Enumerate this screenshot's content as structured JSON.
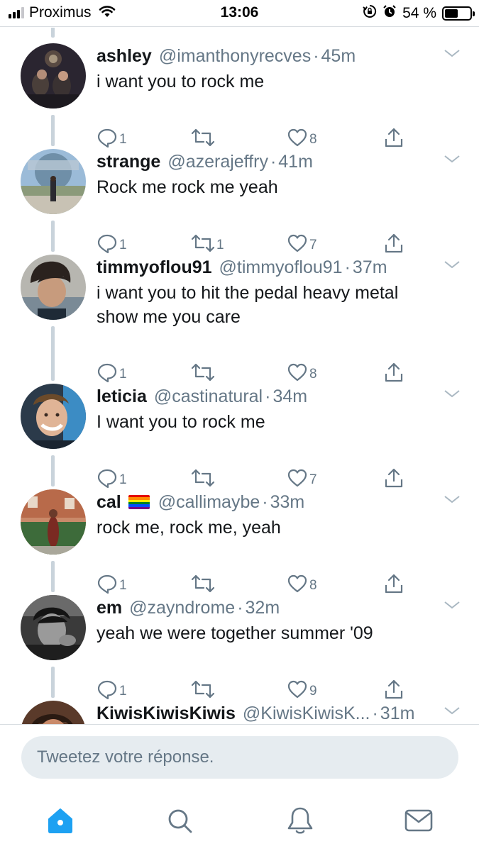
{
  "status_bar": {
    "carrier": "Proximus",
    "time": "13:06",
    "battery_percent": "54 %",
    "battery_level": 0.54
  },
  "tweets": [
    {
      "name": "ashley",
      "handle": "@imanthonyrecves",
      "time": "45m",
      "text": "i want you to rock me",
      "replies": "1",
      "retweets": "",
      "likes": "8"
    },
    {
      "name": "strange",
      "handle": "@azerajeffry",
      "time": "41m",
      "text": "Rock me rock me yeah",
      "replies": "1",
      "retweets": "1",
      "likes": "7"
    },
    {
      "name": "timmyoflou91",
      "handle": "@timmyoflou91",
      "time": "37m",
      "text_line1": "i want you to hit the pedal heavy metal",
      "text_line2": "show me you care",
      "replies": "1",
      "retweets": "",
      "likes": "8"
    },
    {
      "name": "leticia",
      "handle": "@castinatural",
      "time": "34m",
      "text": "I want you to rock me",
      "replies": "1",
      "retweets": "",
      "likes": "7"
    },
    {
      "name": "cal",
      "handle": "@callimaybe",
      "time": "33m",
      "text": "rock me, rock me, yeah",
      "replies": "1",
      "retweets": "",
      "likes": "8"
    },
    {
      "name": "em",
      "handle": "@zayndrome",
      "time": "32m",
      "text": "yeah we were together summer '09",
      "replies": "1",
      "retweets": "",
      "likes": "9"
    },
    {
      "name": "KiwisKiwisKiwis",
      "handle": "@KiwisKiwisK...",
      "time": "31m"
    }
  ],
  "reply_bar": {
    "placeholder": "Tweetez votre réponse."
  },
  "tab_bar": {
    "items": [
      "home-icon",
      "search-icon",
      "notifications-icon",
      "messages-icon"
    ],
    "active": "home-icon"
  },
  "colors": {
    "accent": "#1da1f2",
    "text_primary": "#14171a",
    "text_secondary": "#657786",
    "thread_line": "#c9d3db",
    "reply_input_bg": "#e6ecf0"
  }
}
